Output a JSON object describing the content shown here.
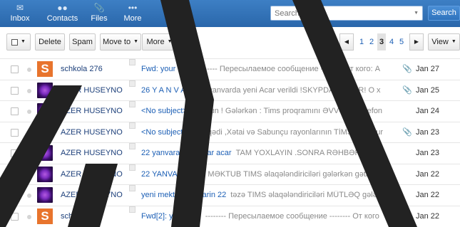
{
  "nav": {
    "inbox": {
      "label": "Inbox",
      "icon": "mail-icon"
    },
    "contacts": {
      "label": "Contacts",
      "icon": "people-icon"
    },
    "files": {
      "label": "Files",
      "icon": "paperclip-icon"
    },
    "more": {
      "label": "More",
      "icon": "dots-icon"
    }
  },
  "search": {
    "placeholder": "Search email",
    "button_label": "Search"
  },
  "toolbar": {
    "delete_label": "Delete",
    "spam_label": "Spam",
    "moveto_label": "Move to",
    "more_label": "More",
    "view_label": "View"
  },
  "pager": {
    "pages": [
      "1",
      "2",
      "3",
      "4",
      "5"
    ],
    "current": "3"
  },
  "messages": [
    {
      "sender": "schkola 276",
      "avatar": "S",
      "subject": "Fwd: your mail",
      "preview": "-------- Пересылаемое сообщение -------- От кого: A",
      "attachment": true,
      "date": "Jan 27"
    },
    {
      "sender": "AZER HUSEYNO",
      "avatar": "eye",
      "subject": "26 Y A N V A R",
      "preview": "24 yanvarda yeni Acar verildi !SKYPDA DA VAR! O x",
      "attachment": true,
      "date": "Jan 25"
    },
    {
      "sender": "AZER HUSEYNO",
      "avatar": "eye",
      "subject": "<No subject>",
      "preview": "Oxuyun ! Gələrkən : Tims proqramını ƏVVƏLKİ telefon",
      "attachment": false,
      "date": "Jan 24"
    },
    {
      "sender": "AZER HUSEYNO",
      "avatar": "eye",
      "subject": "<No subject>",
      "preview": "Binəqədi ,Xətai və Sabunçu rayonlarının TİMS üzrə kur",
      "attachment": true,
      "date": "Jan 23"
    },
    {
      "sender": "AZER HUSEYNO",
      "avatar": "eye",
      "subject": "22 yanvara yeni acar acar",
      "preview": "TAM YOXLAYIN .SONRA RƏHBƏRLİY Y",
      "attachment": false,
      "date": "Jan 23"
    },
    {
      "sender": "AZER HUSEYNO",
      "avatar": "eye",
      "subject": "22 YANVAR",
      "preview": "YENİ MƏKTUB TIMS əlaqələndiriciləri gələrkən gətirməl",
      "attachment": false,
      "date": "Jan 22"
    },
    {
      "sender": "AZER HUSEYNO",
      "avatar": "eye",
      "subject": "yeni mektub yanvarin 22",
      "preview": "təzə TIMS əlaqələndiriciləri MÜTLƏQ gələrk",
      "attachment": false,
      "date": "Jan 22"
    },
    {
      "sender": "schkola 276",
      "avatar": "S",
      "subject": "Fwd[2]: your mail",
      "preview": "-------- Пересылаемое сообщение -------- От кого",
      "attachment": true,
      "date": "Jan 22"
    }
  ]
}
